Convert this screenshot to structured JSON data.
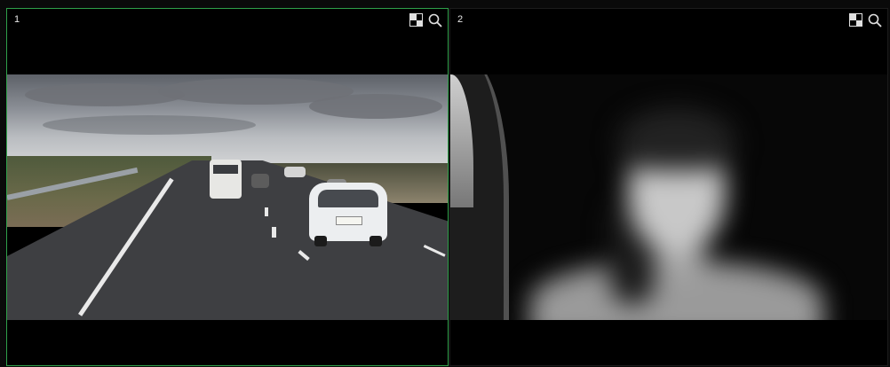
{
  "cameras": [
    {
      "number": "1",
      "selected": true,
      "view": "road-facing",
      "tools": [
        "layout-toggle-icon",
        "search-zoom-icon"
      ]
    },
    {
      "number": "2",
      "selected": false,
      "view": "driver-facing",
      "tools": [
        "layout-toggle-icon",
        "search-zoom-icon"
      ]
    }
  ],
  "colors": {
    "selected_border": "#2fa04a",
    "background": "#000000",
    "label_text": "#e8e8e8"
  }
}
